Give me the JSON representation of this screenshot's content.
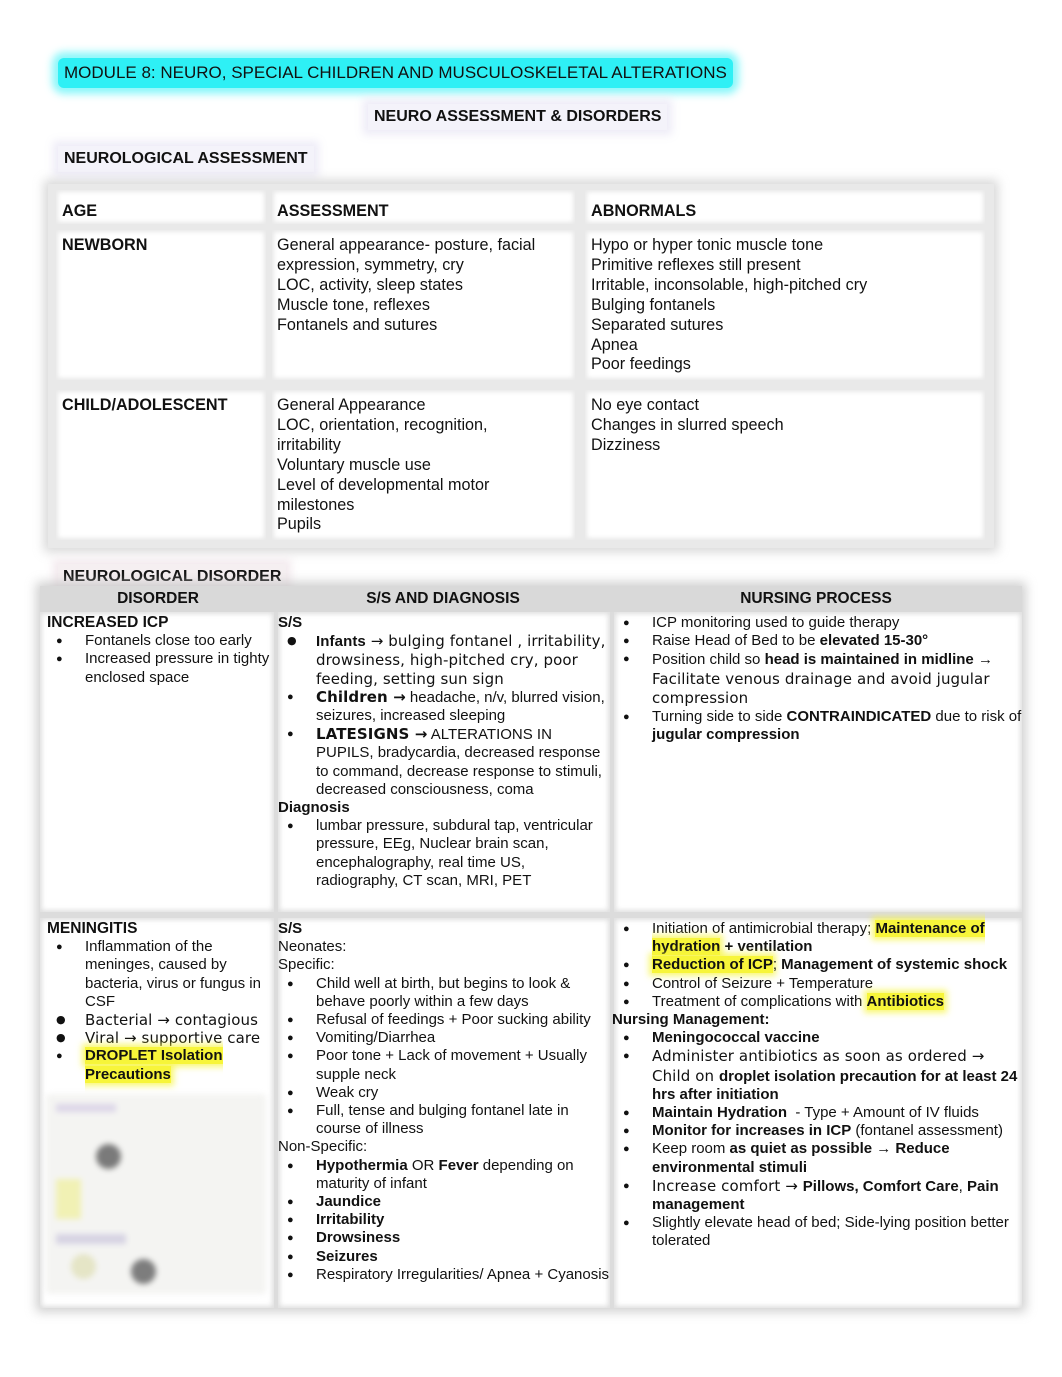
{
  "header": {
    "module_title": "MODULE 8: NEURO, SPECIAL CHILDREN AND MUSCULOSKELETAL ALTERATIONS",
    "section_title": "NEURO ASSESSMENT & DISORDERS",
    "assessment_heading": "NEUROLOGICAL ASSESSMENT",
    "highlight_color": "#2ef0f5"
  },
  "assessment_table": {
    "columns": [
      "AGE",
      "ASSESSMENT",
      "ABNORMALS"
    ],
    "rows": [
      {
        "age": "NEWBORN",
        "assessment": [
          "General appearance- posture, facial",
          "expression, symmetry, cry",
          "LOC, activity, sleep states",
          "Muscle tone, reflexes",
          "Fontanels and sutures"
        ],
        "abnormals": [
          "Hypo or hyper tonic muscle tone",
          "Primitive reflexes still present",
          "Irritable, inconsolable, high-pitched cry",
          "Bulging fontanels",
          "Separated sutures",
          "Apnea",
          "Poor feedings"
        ]
      },
      {
        "age": "CHILD/ADOLESCENT",
        "assessment": [
          "General Appearance",
          "LOC, orientation, recognition,",
          "irritability",
          "Voluntary muscle use",
          "Level of developmental motor",
          "milestones",
          "Pupils"
        ],
        "abnormals": [
          "No eye contact",
          "Changes in slurred speech",
          "Dizziness"
        ]
      }
    ]
  },
  "disorder_table": {
    "heading": "NEUROLOGICAL DISORDER",
    "columns": [
      "DISORDER",
      "S/S AND DIAGNOSIS",
      "NURSING PROCESS"
    ],
    "highlight_color": "#f7f53a",
    "icp": {
      "name": "INCREASED ICP",
      "bullets": [
        "Fontanels close too early",
        "Increased pressure in tighty enclosed space"
      ],
      "ss_label": "S/S",
      "ss": [
        {
          "bold": "Infants",
          "text": " → bulging fontanel , irritability, drowsiness, high-pitched cry, poor feeding, setting sun sign"
        },
        {
          "bold": "Children →",
          "text": " headache, n/v, blurred vision, seizures, increased sleeping"
        },
        {
          "bold": "LATESIGNS →",
          "text": " ALTERATIONS IN PUPILS, bradycardia, decreased response to command, decrease response to stimuli, decreased consciousness, coma"
        }
      ],
      "diagnosis_label": "Diagnosis",
      "diagnosis": [
        "lumbar pressure, subdural tap, ventricular pressure, EEg, Nuclear brain scan, encephalography, real time US, radiography, CT scan, MRI, PET"
      ],
      "nursing": {
        "n1": "ICP monitoring used to guide therapy",
        "n2_text": "Raise Head of Bed to be ",
        "n2_bold": "elevated 15-30°",
        "n3_text": "Position child so ",
        "n3_bold": "head is maintained in midline →",
        "n3_rest": " Facilitate venous drainage and avoid jugular compression",
        "n4_text": "Turning side to side ",
        "n4_bold": "CONTRAINDICATED",
        "n4_mid": " due to risk of ",
        "n4_bold2": "jugular compression"
      }
    },
    "meningitis": {
      "name": "MENINGITIS",
      "bullets": {
        "b1": "Inflammation of the meninges, caused by bacteria, virus or fungus in CSF",
        "b2": "Bacterial → contagious",
        "b3": "Viral → supportive care",
        "b4": "DROPLET Isolation Precautions"
      },
      "ss_label": "S/S",
      "neonates_label": "Neonates:",
      "specific_label": "Specific:",
      "specific": [
        "Child well at birth, but begins to look & behave poorly within a few days",
        "Refusal of feedings + Poor sucking ability",
        "Vomiting/Diarrhea",
        "Poor tone + Lack of movement + Usually supple neck",
        "Weak cry",
        "Full, tense and bulging fontanel late in course of illness"
      ],
      "nonspecific_label": "Non-Specific:",
      "nonspecific": {
        "n1_bold": "Hypothermia",
        "n1_mid": " OR ",
        "n1_bold2": "Fever",
        "n1_rest": " depending on maturity of infant",
        "n2": "Jaundice",
        "n3": "Irritability",
        "n4": "Drowsiness",
        "n5": "Seizures",
        "n6": "Respiratory Irregularities/ Apnea + Cyanosis"
      },
      "nursing": {
        "p1_text": "Initiation of antimicrobial therapy; ",
        "p1_hl": "Maintenance of hydration",
        "p1_bold": " + ventilation",
        "p2_hl": "Reduction of ICP",
        "p2_text": "; ",
        "p2_bold": "Management of systemic shock",
        "p3": "Control of Seizure + Temperature",
        "p4_text": "Treatment of complications with ",
        "p4_hl": "Antibiotics",
        "mgmt_label": "Nursing Management:",
        "m1": "Meningococcal vaccine",
        "m2_text": "Administer antibiotics as soon as ordered → Child on ",
        "m2_bold": "droplet isolation precaution for at least 24 hrs after initiation",
        "m3_bold": "Maintain Hydration",
        "m3_text": "  - Type + Amount of IV fluids",
        "m4_bold": "Monitor for increases in ICP",
        "m4_text": " (fontanel assessment)",
        "m5_text": "Keep room ",
        "m5_bold": "as quiet as possible → Reduce environmental stimuli",
        "m6_text": "Increase comfort → ",
        "m6_bold": "Pillows, Comfort Care",
        "m6_mid": ", ",
        "m6_bold2": "Pain management",
        "m7": "Slightly elevate head of bed; Side-lying position better tolerated"
      }
    }
  }
}
